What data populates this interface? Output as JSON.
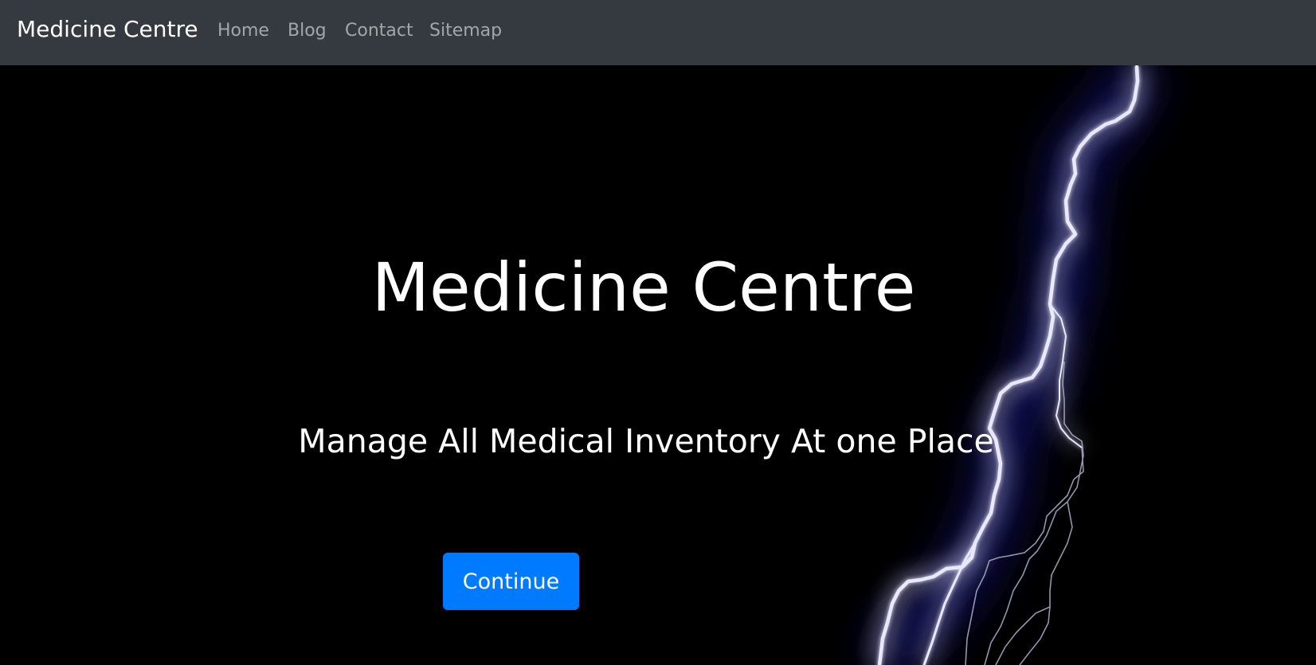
{
  "navbar": {
    "brand": "Medicine Centre",
    "links": [
      {
        "label": "Home"
      },
      {
        "label": "Blog"
      },
      {
        "label": "Contact"
      },
      {
        "label": "Sitemap"
      }
    ]
  },
  "hero": {
    "title": "Medicine Centre",
    "subtitle": "Manage All Medical Inventory At one Place",
    "button_label": "Continue"
  },
  "colors": {
    "navbar_bg": "#343a40",
    "hero_bg": "#000000",
    "button_bg": "#007bff",
    "text": "#ffffff",
    "nav_link": "rgba(255,255,255,0.55)",
    "lightning_glow": "#2a2aa0"
  },
  "icons": {
    "hero_background": "lightning-bolt-image"
  }
}
